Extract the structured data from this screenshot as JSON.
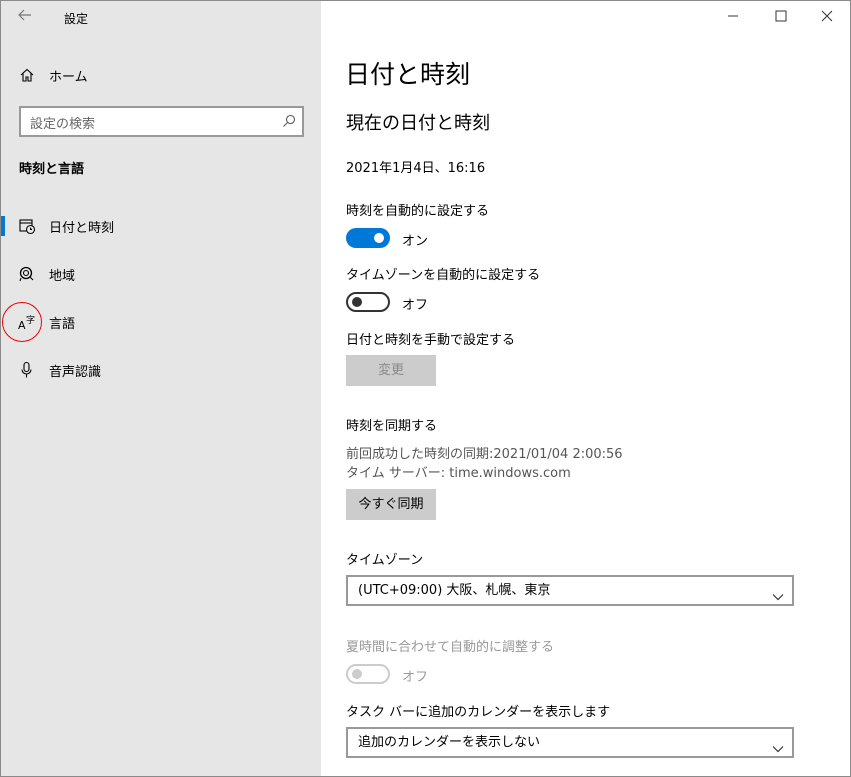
{
  "window": {
    "app_title": "設定",
    "back_icon": "back-arrow-icon",
    "controls": [
      "minimize-icon",
      "maximize-icon",
      "close-icon"
    ]
  },
  "sidebar": {
    "home_label": "ホーム",
    "search_placeholder": "設定の検索",
    "section_title": "時刻と言語",
    "items": [
      {
        "label": "日付と時刻",
        "icon": "calendar-clock-icon",
        "active": true
      },
      {
        "label": "地域",
        "icon": "globe-icon",
        "active": false
      },
      {
        "label": "言語",
        "icon": "language-icon",
        "active": false,
        "annotated": true
      },
      {
        "label": "音声認識",
        "icon": "microphone-icon",
        "active": false
      }
    ]
  },
  "main": {
    "title": "日付と時刻",
    "subtitle": "現在の日付と時刻",
    "current_datetime": "2021年1月4日、16:16",
    "auto_time": {
      "label": "時刻を自動的に設定する",
      "state": "オン"
    },
    "auto_timezone": {
      "label": "タイムゾーンを自動的に設定する",
      "state": "オフ"
    },
    "manual": {
      "label": "日付と時刻を手動で設定する",
      "button": "変更"
    },
    "sync": {
      "heading": "時刻を同期する",
      "last_sync": "前回成功した時刻の同期:2021/01/04 2:00:56",
      "server": "タイム サーバー: time.windows.com",
      "button": "今すぐ同期"
    },
    "timezone": {
      "label": "タイムゾーン",
      "value": "(UTC+09:00) 大阪、札幌、東京"
    },
    "dst": {
      "label": "夏時間に合わせて自動的に調整する",
      "state": "オフ"
    },
    "calendar": {
      "label": "タスク バーに追加のカレンダーを表示します",
      "value": "追加のカレンダーを表示しない"
    }
  },
  "colors": {
    "accent": "#0078d7",
    "sidebar_bg": "#e6e6e6",
    "annotation": "#e00000"
  }
}
